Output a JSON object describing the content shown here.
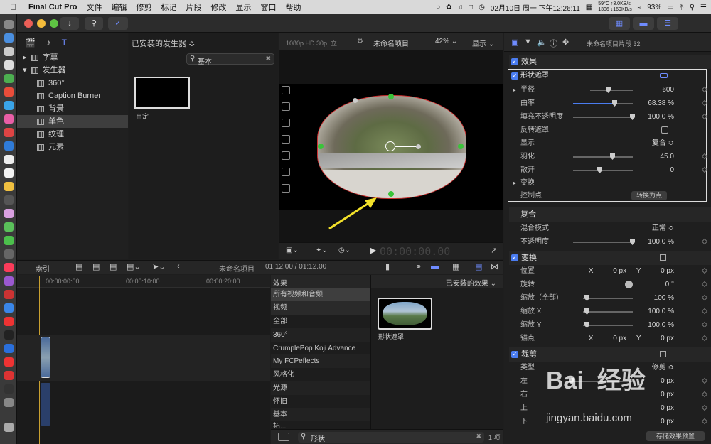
{
  "menubar": {
    "app_name": "Final Cut Pro",
    "menus": [
      "文件",
      "编辑",
      "修剪",
      "标记",
      "片段",
      "修改",
      "显示",
      "窗口",
      "帮助"
    ],
    "net_up": "59°C ↑3.0KB/s",
    "net_down": "1306 ↓169KB/s",
    "datetime": "02月10日 周一 下午12:26:11",
    "battery": "93%"
  },
  "browser": {
    "title": "已安装的发生器 ≎",
    "search_value": "基本",
    "tree": [
      "字幕",
      "发生器",
      "360°",
      "Caption Burner",
      "背景",
      "单色",
      "纹理",
      "元素"
    ],
    "selected_item": "单色",
    "thumb_label": "自定"
  },
  "viewer": {
    "format": "1080p HD 30p, 立...",
    "project": "未命名项目",
    "zoom": "42% ⌄",
    "view": "显示 ⌄",
    "timecode": "00:00:00.00"
  },
  "inspector": {
    "clip_title": "未命名项目片段 32",
    "effects_header": "效果",
    "shape_mask": "形状遮罩",
    "rows": [
      {
        "label": "半径",
        "value": "600"
      },
      {
        "label": "曲率",
        "value": "68.38 %"
      },
      {
        "label": "填充不透明度",
        "value": "100.0 %"
      },
      {
        "label": "反转遮罩",
        "value": ""
      },
      {
        "label": "显示",
        "value": "复合 ≎"
      },
      {
        "label": "羽化",
        "value": "45.0"
      },
      {
        "label": "散开",
        "value": "0"
      },
      {
        "label": "变换",
        "value": ""
      },
      {
        "label": "控制点",
        "value": "转换为点"
      }
    ],
    "composite_header": "复合",
    "composite_rows": [
      {
        "label": "混合模式",
        "value": "正常 ≎"
      },
      {
        "label": "不透明度",
        "value": "100.0 %"
      }
    ],
    "transform_header": "变换",
    "transform_rows": [
      {
        "label": "位置",
        "value": "X          0 px     Y          0 px"
      },
      {
        "label": "旋转",
        "value": "0 °"
      },
      {
        "label": "缩放（全部）",
        "value": "100 %"
      },
      {
        "label": "缩放 X",
        "value": "100.0 %"
      },
      {
        "label": "缩放 Y",
        "value": "100.0 %"
      },
      {
        "label": "锚点",
        "value": "X          0 px     Y          0 px"
      }
    ],
    "crop_header": "裁剪",
    "crop_rows": [
      {
        "label": "类型",
        "value": "修剪 ≎"
      },
      {
        "label": "左",
        "value": "0 px"
      },
      {
        "label": "右",
        "value": "0 px"
      },
      {
        "label": "上",
        "value": "0 px"
      },
      {
        "label": "下",
        "value": "0 px"
      }
    ],
    "save_preset": "存储效果预置"
  },
  "timeline": {
    "index_label": "索引",
    "project": "未命名项目",
    "duration": "01:12.00 / 01:12.00",
    "ruler": [
      "00:00:00:00",
      "00:00:10:00",
      "00:00:20:00"
    ]
  },
  "effects_browser": {
    "title": "效果",
    "categories": [
      "所有视频和音频",
      "视频",
      "全部",
      "360°",
      "CrumplePop Koji Advance",
      "My FCPeffects",
      "风格化",
      "光源",
      "怀旧",
      "基本",
      "拓..."
    ],
    "filter": "已安装的效果 ⌄",
    "effect_name": "形状遮罩",
    "search_value": "形状",
    "count": "1 项"
  },
  "watermark": {
    "brand": "Bai  经验",
    "url": "jingyan.baidu.com"
  }
}
